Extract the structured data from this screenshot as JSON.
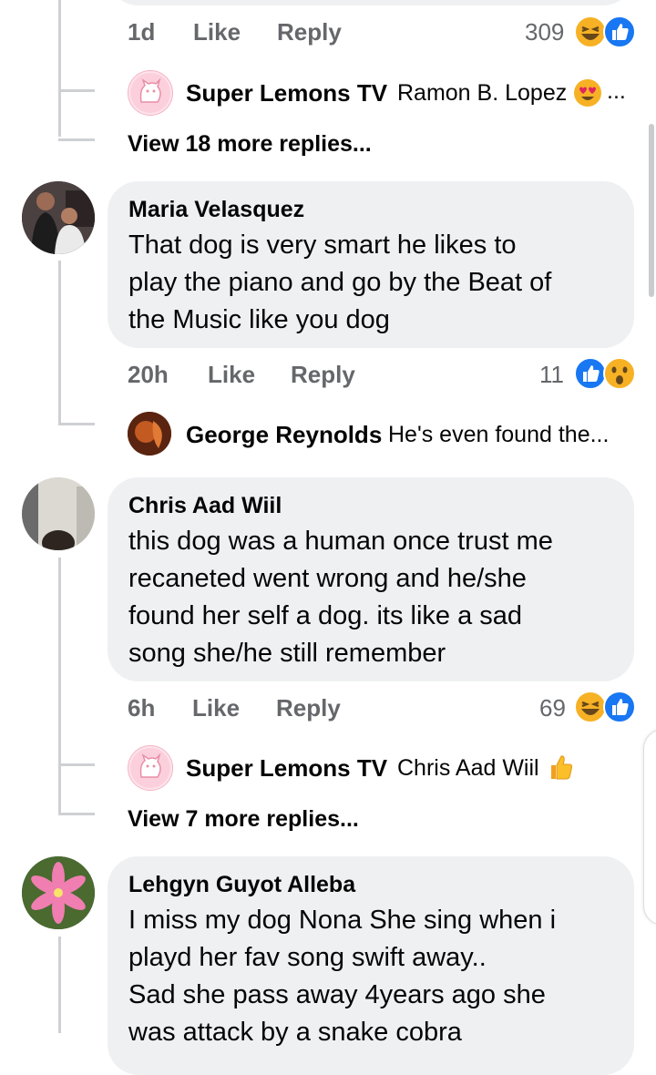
{
  "thread_top": {
    "meta": {
      "time": "1d",
      "like": "Like",
      "reply": "Reply",
      "count": "309"
    },
    "reply_preview": {
      "name": "Super Lemons TV",
      "text": "Ramon B. Lopez",
      "ellipsis": "..."
    },
    "view_more": "View 18 more replies..."
  },
  "comments": [
    {
      "name": "Maria Velasquez",
      "lines": [
        "That dog is very smart he likes to",
        "play the piano and go by the Beat of",
        "the Music like you dog"
      ],
      "time": "20h",
      "like": "Like",
      "reply": "Reply",
      "count": "11",
      "reply_preview": {
        "name": "George Reynolds",
        "text": "He's even found the..."
      }
    },
    {
      "name": "Chris Aad Wiil",
      "lines": [
        "this dog was a human once trust me",
        "recaneted went wrong and he/she",
        "found her self a dog. its like a sad",
        "song she/he still remember"
      ],
      "time": "6h",
      "like": "Like",
      "reply": "Reply",
      "count": "69",
      "reply_preview": {
        "name": "Super Lemons TV",
        "text": "Chris Aad Wiil"
      },
      "view_more": "View 7 more replies..."
    },
    {
      "name": "Lehgyn Guyot Alleba",
      "lines": [
        "I miss my dog Nona She sing when i",
        "playd her fav song swift away..",
        "Sad she pass away 4years ago she",
        "was attack by a snake cobra"
      ]
    }
  ],
  "colors": {
    "bubble": "#eff0f2",
    "like_blue": "#1877f2",
    "haha_yellow": "#f7b125",
    "text_gray": "#65676b"
  }
}
